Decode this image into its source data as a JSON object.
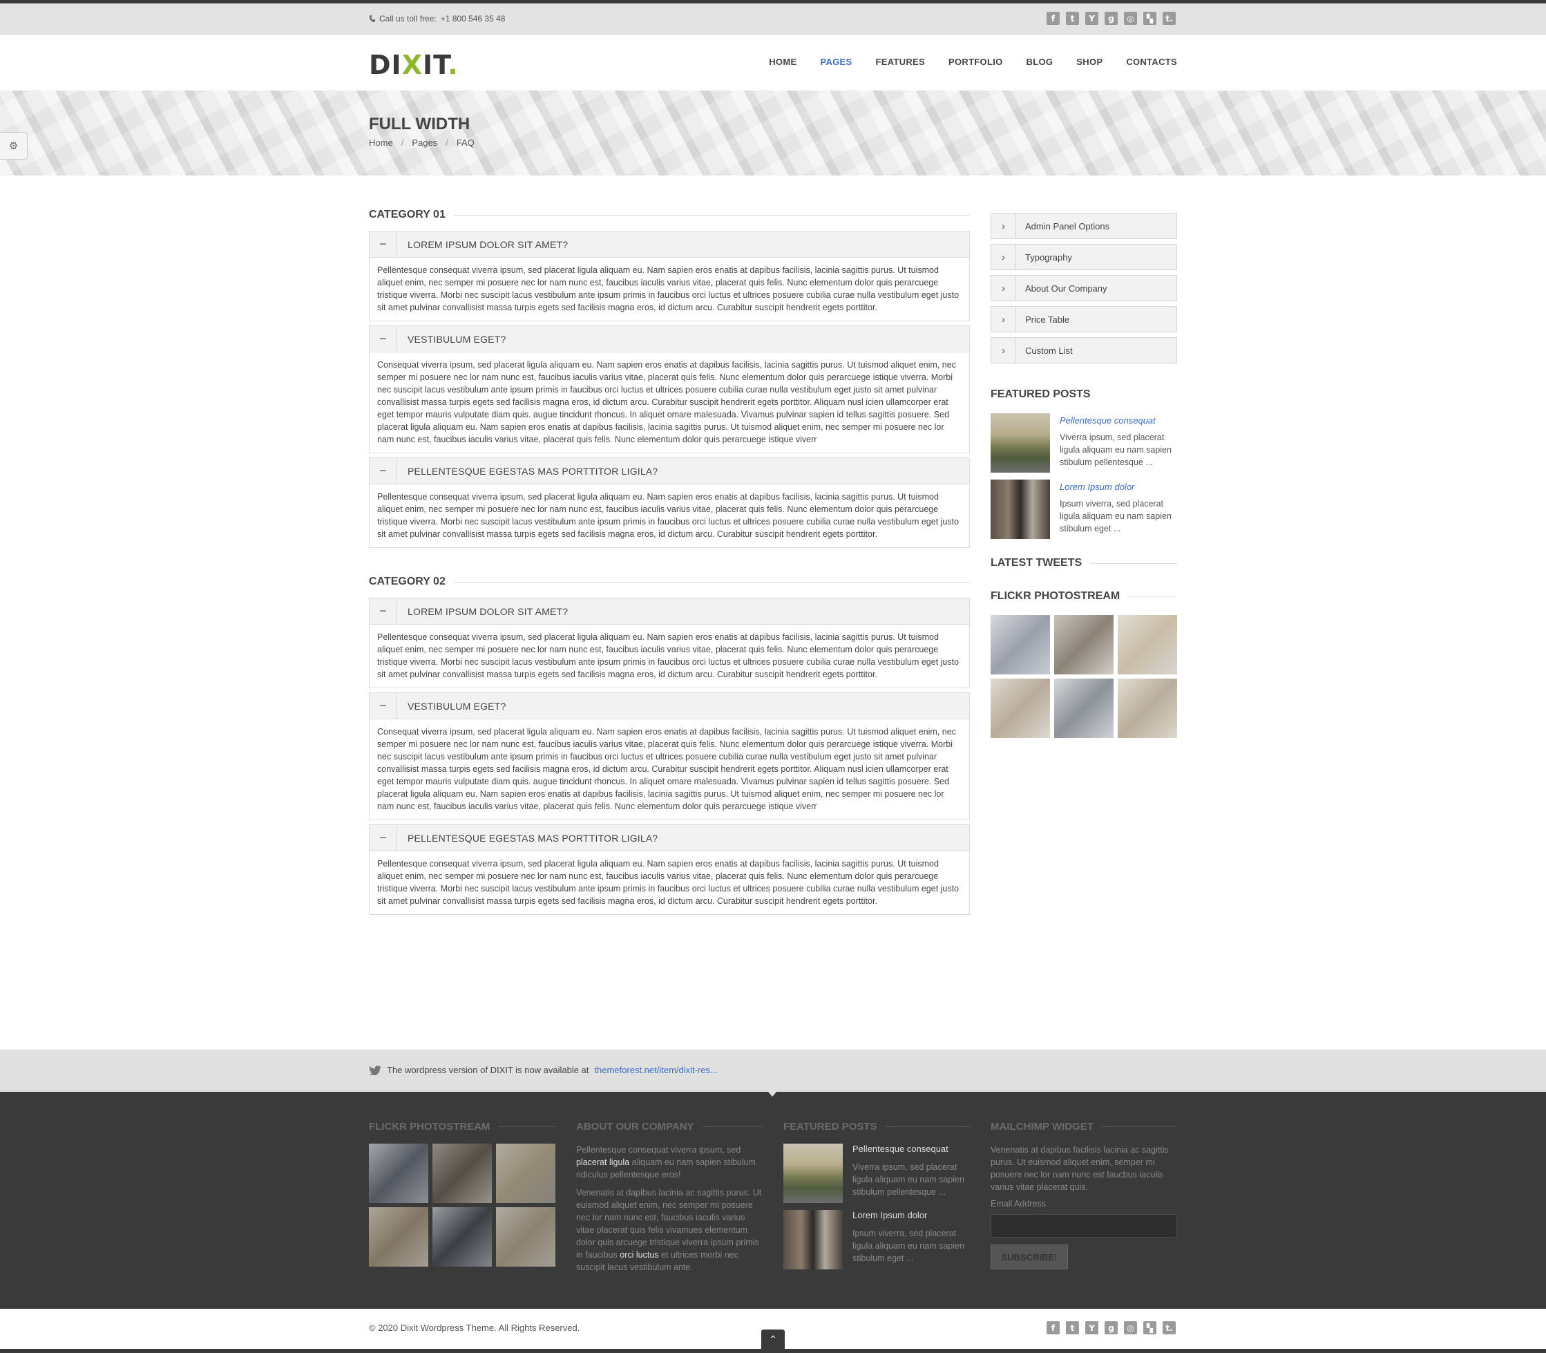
{
  "topbar": {
    "call": "Call us toll free:",
    "phone": "+1 800 546 35 48"
  },
  "socials": [
    {
      "icon": "facebook-icon",
      "glyph": "f"
    },
    {
      "icon": "twitter-icon",
      "glyph": "t"
    },
    {
      "icon": "youtube-icon",
      "glyph": "Y"
    },
    {
      "icon": "googleplus-icon",
      "glyph": "g"
    },
    {
      "icon": "dribbble-icon",
      "glyph": "◎"
    },
    {
      "icon": "delicious-icon",
      "glyph": "▚"
    },
    {
      "icon": "tumblr-icon",
      "glyph": "t."
    }
  ],
  "logo": {
    "a": "DI",
    "x": "X",
    "b": "IT",
    "dot": "."
  },
  "nav": [
    "HOME",
    "PAGES",
    "FEATURES",
    "PORTFOLIO",
    "BLOG",
    "SHOP",
    "CONTACTS"
  ],
  "nav_active": "PAGES",
  "banner": {
    "title": "FULL WIDTH",
    "crumbs": [
      "Home",
      "Pages",
      "FAQ"
    ]
  },
  "categories": [
    {
      "title": "CATEGORY 01",
      "items": [
        {
          "q": "LOREM IPSUM DOLOR SIT AMET?",
          "a": "Pellentesque consequat viverra ipsum, sed placerat ligula aliquam eu. Nam sapien eros enatis at dapibus facilisis, lacinia sagittis purus. Ut tuismod aliquet enim, nec semper mi posuere nec lor nam nunc est, faucibus iaculis varius vitae, placerat quis felis. Nunc elementum dolor quis perarcuege tristique viverra. Morbi nec suscipit lacus vestibulum ante ipsum primis in faucibus orci luctus et ultrices posuere cubilia curae nulla vestibulum eget justo sit amet pulvinar convallisist massa turpis egets sed facilisis magna eros, id dictum arcu. Curabitur suscipit hendrerit egets porttitor."
        },
        {
          "q": "VESTIBULUM EGET?",
          "a": "Consequat viverra ipsum, sed placerat ligula aliquam eu. Nam sapien eros enatis at dapibus facilisis, lacinia sagittis purus. Ut tuismod aliquet enim, nec semper mi posuere nec lor nam nunc est, faucibus iaculis varius vitae, placerat quis felis. Nunc elementum dolor quis perarcuege istique viverra. Morbi nec suscipit lacus vestibulum ante ipsum primis in faucibus orci luctus et ultrices posuere cubilia curae nulla vestibulum eget justo sit amet pulvinar convallisist massa turpis egets sed facilisis magna eros, id dictum arcu. Curabitur suscipit hendrerit egets porttitor. Aliquam nusl icien ullamcorper erat eget tempor mauris vulputate diam quis. augue tincidunt rhoncus. In aliquet omare malesuada. Vivamus pulvinar sapien id tellus sagittis posuere. Sed placerat ligula aliquam eu. Nam sapien eros enatis at dapibus facilisis, lacinia sagittis purus. Ut tuismod aliquet enim, nec semper mi posuere nec lor nam nunc est, faucibus iaculis varius vitae, placerat quis felis. Nunc elementum dolor quis perarcuege istique viverr"
        },
        {
          "q": "PELLENTESQUE EGESTAS MAS PORTTITOR LIGILA?",
          "a": "Pellentesque consequat viverra ipsum, sed placerat ligula aliquam eu. Nam sapien eros enatis at dapibus facilisis, lacinia sagittis purus. Ut tuismod aliquet enim, nec semper mi posuere nec lor nam nunc est, faucibus iaculis varius vitae, placerat quis felis. Nunc elementum dolor quis perarcuege tristique viverra. Morbi nec suscipit lacus vestibulum ante ipsum primis in faucibus orci luctus et ultrices posuere cubilia curae nulla vestibulum eget justo sit amet pulvinar convallisist massa turpis egets sed facilisis magna eros, id dictum arcu. Curabitur suscipit hendrerit egets porttitor."
        }
      ]
    },
    {
      "title": "CATEGORY 02",
      "items": [
        {
          "q": "LOREM IPSUM DOLOR SIT AMET?",
          "a": "Pellentesque consequat viverra ipsum, sed placerat ligula aliquam eu. Nam sapien eros enatis at dapibus facilisis, lacinia sagittis purus. Ut tuismod aliquet enim, nec semper mi posuere nec lor nam nunc est, faucibus iaculis varius vitae, placerat quis felis. Nunc elementum dolor quis perarcuege tristique viverra. Morbi nec suscipit lacus vestibulum ante ipsum primis in faucibus orci luctus et ultrices posuere cubilia curae nulla vestibulum eget justo sit amet pulvinar convallisist massa turpis egets sed facilisis magna eros, id dictum arcu. Curabitur suscipit hendrerit egets porttitor."
        },
        {
          "q": "VESTIBULUM EGET?",
          "a": "Consequat viverra ipsum, sed placerat ligula aliquam eu. Nam sapien eros enatis at dapibus facilisis, lacinia sagittis purus. Ut tuismod aliquet enim, nec semper mi posuere nec lor nam nunc est, faucibus iaculis varius vitae, placerat quis felis. Nunc elementum dolor quis perarcuege istique viverra. Morbi nec suscipit lacus vestibulum ante ipsum primis in faucibus orci luctus et ultrices posuere cubilia curae nulla vestibulum eget justo sit amet pulvinar convallisist massa turpis egets sed facilisis magna eros, id dictum arcu. Curabitur suscipit hendrerit egets porttitor. Aliquam nusl icien ullamcorper erat eget tempor mauris vulputate diam quis. augue tincidunt rhoncus. In aliquet omare malesuada. Vivamus pulvinar sapien id tellus sagittis posuere. Sed placerat ligula aliquam eu. Nam sapien eros enatis at dapibus facilisis, lacinia sagittis purus. Ut tuismod aliquet enim, nec semper mi posuere nec lor nam nunc est, faucibus iaculis varius vitae, placerat quis felis. Nunc elementum dolor quis perarcuege istique viverr"
        },
        {
          "q": "PELLENTESQUE EGESTAS MAS PORTTITOR LIGILA?",
          "a": "Pellentesque consequat viverra ipsum, sed placerat ligula aliquam eu. Nam sapien eros enatis at dapibus facilisis, lacinia sagittis purus. Ut tuismod aliquet enim, nec semper mi posuere nec lor nam nunc est, faucibus iaculis varius vitae, placerat quis felis. Nunc elementum dolor quis perarcuege tristique viverra. Morbi nec suscipit lacus vestibulum ante ipsum primis in faucibus orci luctus et ultrices posuere cubilia curae nulla vestibulum eget justo sit amet pulvinar convallisist massa turpis egets sed facilisis magna eros, id dictum arcu. Curabitur suscipit hendrerit egets porttitor."
        }
      ]
    }
  ],
  "sidebar": {
    "menu": [
      "Admin Panel Options",
      "Typography",
      "About Our Company",
      "Price Table",
      "Custom List"
    ],
    "featured_title": "FEATURED POSTS",
    "featured": [
      {
        "title": "Pellentesque consequat",
        "desc": "Viverra ipsum, sed placerat ligula aliquam eu nam sapien stibulum pellentesque ..."
      },
      {
        "title": "Lorem Ipsum dolor",
        "desc": "Ipsum viverra, sed placerat ligula aliquam eu nam sapien stibulum eget ..."
      }
    ],
    "tweets_title": "LATEST TWEETS",
    "flickr_title": "FLICKR PHOTOSTREAM"
  },
  "notice": {
    "text": "The wordpress version of DIXIT is now available at",
    "link": "themeforest.net/item/dixit-res..."
  },
  "footer": {
    "flickr_title": "FLICKR PHOTOSTREAM",
    "about_title": "ABOUT OUR COMPANY",
    "about_p1_a": "Pellentesque consequat viverra ipsum, sed",
    "about_p1_b": "placerat ligula",
    "about_p1_c": "aliquam eu nam sapien stibulum ridiculus pellentesque eros!",
    "about_p2_a": "Venenatis at dapibus lacinia ac sagittis purus. Ut euismod aliquet enim, nec semper mi posuere nec lor nam nunc est, faucibus iaculis varius vitae placerat quis felis vivamues elementum dolor quis arcuege tristique viverra ipsum primis in faucibus",
    "about_p2_b": "orci luctus",
    "about_p2_c": "et ultrices morbi nec suscipit lacus vestibulum ante.",
    "featured_title": "FEATURED POSTS",
    "featured": [
      {
        "title": "Pellentesque consequat",
        "desc": "Viverra ipsum, sed placerat ligula aliquam eu nam sapien stibulum pellentesque ..."
      },
      {
        "title": "Lorem Ipsum dolor",
        "desc": "Ipsum viverra, sed placerat ligula aliquam eu nam sapien stibulum eget ..."
      }
    ],
    "mailchimp_title": "MAILCHIMP WIDGET",
    "mailchimp_text": "Venenatis at dapibus facilisis lacinia ac sagittis purus. Ut euismod aliquet enim, semper mi posuere nec lor nam nunc est faucbus iaculis varius vitae placerat quis.",
    "email_label": "Email Address",
    "subscribe": "SUBSCRIBE!"
  },
  "bottom": {
    "copy": "© 2020 Dixit Wordpress Theme. All Rights Reserved."
  },
  "colors": {
    "accent": "#8cb82c",
    "link": "#3b6bc9",
    "footer_bg": "#3a3a3a"
  }
}
